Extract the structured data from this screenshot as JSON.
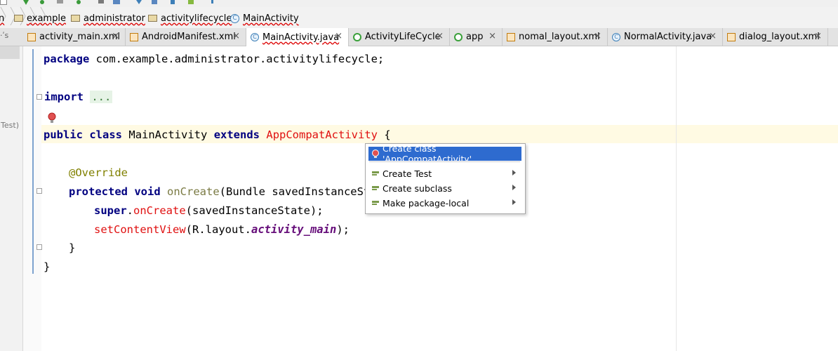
{
  "breadcrumb": {
    "items": [
      {
        "label": "n"
      },
      {
        "label": "example"
      },
      {
        "label": "administrator"
      },
      {
        "label": "activitylifecycle"
      },
      {
        "label": "MainActivity"
      }
    ]
  },
  "tabs": [
    {
      "label": "activity_main.xml",
      "icon": "xml-file-icon"
    },
    {
      "label": "AndroidManifest.xml",
      "icon": "xml-file-icon"
    },
    {
      "label": "MainActivity.java",
      "icon": "java-class-icon",
      "active": true
    },
    {
      "label": "ActivityLifeCycle",
      "icon": "android-module-icon"
    },
    {
      "label": "app",
      "icon": "android-module-icon"
    },
    {
      "label": "nomal_layout.xml",
      "icon": "xml-file-icon"
    },
    {
      "label": "NormalActivity.java",
      "icon": "java-class-icon"
    },
    {
      "label": "dialog_layout.xml",
      "icon": "xml-file-icon"
    }
  ],
  "tab_close_glyph": "×",
  "left_strip_label": "lTest)",
  "code": {
    "line1_kw": "package",
    "line1_rest": " com.example.administrator.activitylifecycle;",
    "line2_kw": "import",
    "line2_dots": "...",
    "line3_kw1": "public",
    "line3_kw2": "class",
    "line3_name": "MainActivity",
    "line3_kw3": "extends",
    "line3_err": "AppCompatActivity",
    "line3_brace": "{",
    "line4_ann": "@Override",
    "line5_kw1": "protected",
    "line5_kw2": "void",
    "line5_fn": "onCreate",
    "line5_rest": "(Bundle savedInstanceSt",
    "line6_kw": "super",
    "line6_dot": ".",
    "line6_call": "onCreate",
    "line6_rest": "(savedInstanceState);",
    "line7_call": "setContentView",
    "line7_mid": "(R.layout.",
    "line7_ital": "activity_main",
    "line7_end": ");",
    "line8": "}",
    "line9": "}"
  },
  "popup": {
    "items": [
      {
        "label": "Create class 'AppCompatActivity'",
        "selected": true,
        "submenu": false
      },
      {
        "label": "Create Test",
        "submenu": true
      },
      {
        "label": "Create subclass",
        "submenu": true
      },
      {
        "label": "Make package-local",
        "submenu": true
      }
    ]
  },
  "colors": {
    "keyword": "#000080",
    "error": "#e01010",
    "annotation": "#808000",
    "selection": "#2e6bcf",
    "current_line": "#fffae3"
  }
}
